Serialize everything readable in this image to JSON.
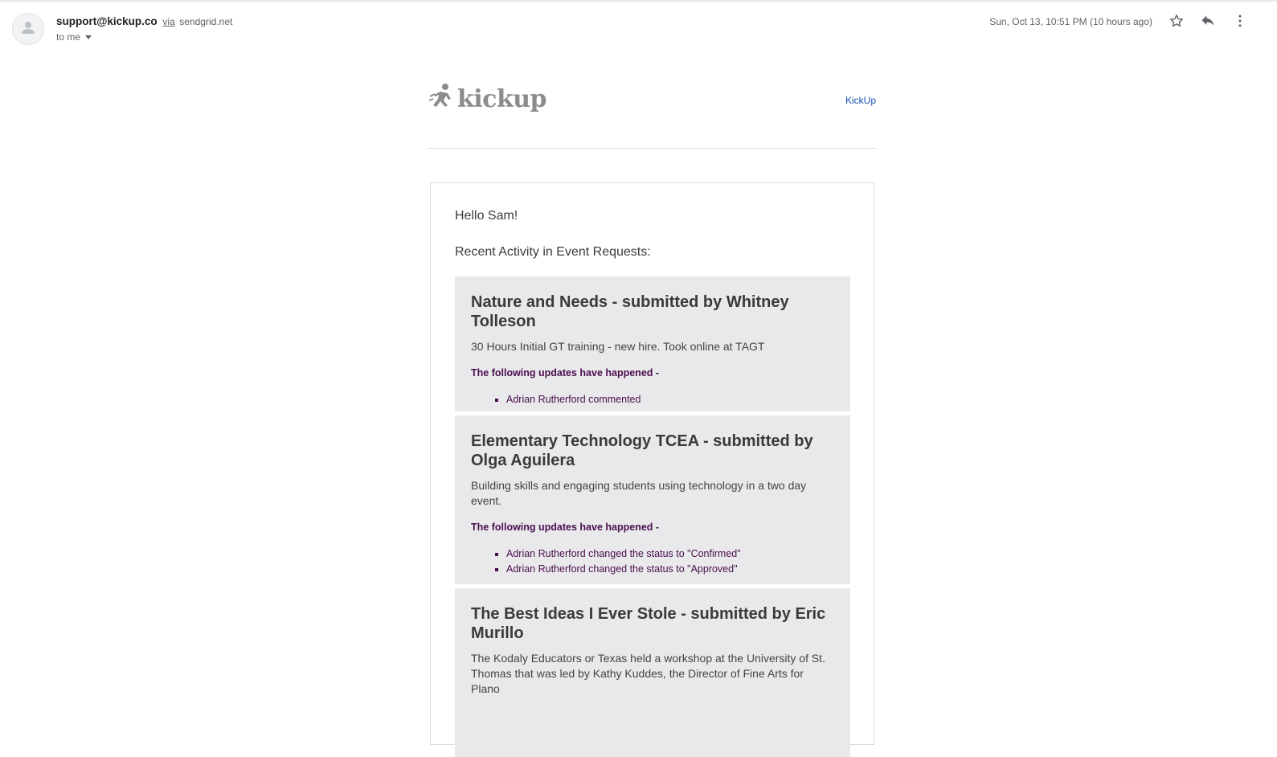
{
  "header": {
    "sender_email": "support@kickup.co",
    "via_label": "via",
    "via_domain": "sendgrid.net",
    "recipient": "to me",
    "timestamp": "Sun, Oct 13, 10:51 PM (10 hours ago)",
    "icons": [
      "person-icon",
      "star-icon",
      "reply-icon",
      "more-vert-icon"
    ]
  },
  "email": {
    "logo_text": "kickup",
    "brand_link": "KickUp",
    "greeting": "Hello Sam!",
    "section_title": "Recent Activity in Event Requests:",
    "requests": [
      {
        "title": "Nature and Needs - submitted by Whitney Tolleson",
        "description": "30 Hours Initial GT training - new hire. Took online at TAGT",
        "updates_label": "The following updates have happened -",
        "updates": [
          "Adrian Rutherford commented"
        ]
      },
      {
        "title": "Elementary Technology TCEA - submitted by Olga Aguilera",
        "description": "Building skills and engaging students using technology in a two day event.",
        "updates_label": "The following updates have happened -",
        "updates": [
          "Adrian Rutherford changed the status to \"Confirmed\"",
          "Adrian Rutherford changed the status to \"Approved\""
        ]
      },
      {
        "title": "The Best Ideas I Ever Stole - submitted by Eric Murillo",
        "description": "The Kodaly Educators or Texas held a workshop at the University of St. Thomas that was led by Kathy Kuddes, the Director of Fine Arts for Plano",
        "updates_label": "",
        "updates": []
      }
    ]
  },
  "colors": {
    "accent_link": "#1a4fb5",
    "update_text": "#4a0e4e",
    "card_bg": "#e9e9eb"
  }
}
